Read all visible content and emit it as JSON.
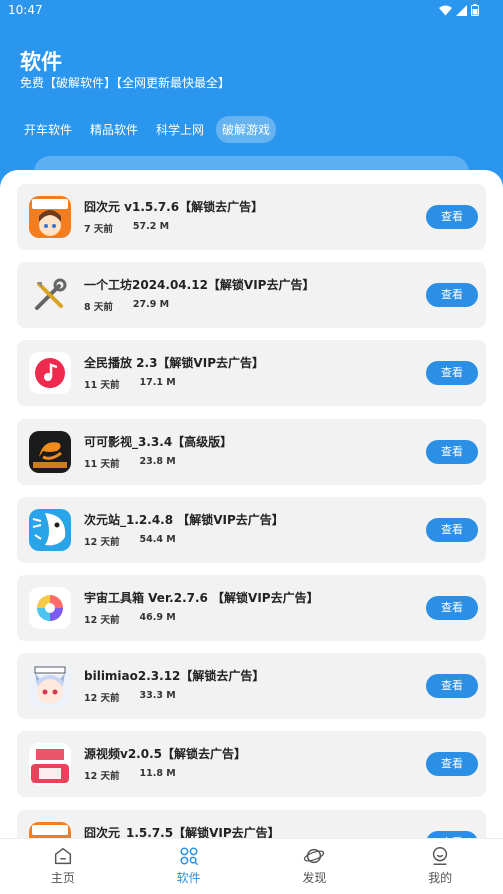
{
  "status": {
    "time": "10:47"
  },
  "header": {
    "title": "软件",
    "subtitle": "免费【破解软件】【全网更新最快最全】"
  },
  "tabs": [
    {
      "label": "开车软件",
      "active": false
    },
    {
      "label": "精品软件",
      "active": false
    },
    {
      "label": "科学上网",
      "active": false
    },
    {
      "label": "破解游戏",
      "active": true
    }
  ],
  "view_label": "查看",
  "apps": [
    {
      "title": "囧次元 v1.5.7.6【解锁去广告】",
      "age": "7 天前",
      "size": "57.2 M",
      "icon": "jiongciyuan-icon"
    },
    {
      "title": "一个工坊2024.04.12【解锁VIP去广告】",
      "age": "8 天前",
      "size": "27.9 M",
      "icon": "tools-icon"
    },
    {
      "title": "全民播放 2.3【解锁VIP去广告】",
      "age": "11 天前",
      "size": "17.1 M",
      "icon": "music-player-icon"
    },
    {
      "title": "可可影视_3.3.4【高级版】",
      "age": "11 天前",
      "size": "23.8 M",
      "icon": "kekys-icon"
    },
    {
      "title": "次元站_1.2.4.8 【解锁VIP去广告】",
      "age": "12 天前",
      "size": "54.4 M",
      "icon": "ciyuanzhan-icon"
    },
    {
      "title": "宇宙工具箱 Ver.2.7.6 【解锁VIP去广告】",
      "age": "12 天前",
      "size": "46.9 M",
      "icon": "universe-toolbox-icon"
    },
    {
      "title": "bilimiao2.3.12【解锁去广告】",
      "age": "12 天前",
      "size": "33.3 M",
      "icon": "bilimiao-icon"
    },
    {
      "title": "源视频v2.0.5【解锁去广告】",
      "age": "12 天前",
      "size": "11.8 M",
      "icon": "youyuan-video-icon"
    },
    {
      "title": "囧次元_1.5.7.5【解锁VIP去广告】",
      "age": "",
      "size": "",
      "icon": "jiongciyuan-icon"
    }
  ],
  "nav": [
    {
      "label": "主页",
      "icon": "home-icon",
      "active": false
    },
    {
      "label": "软件",
      "icon": "apps-icon",
      "active": true
    },
    {
      "label": "发现",
      "icon": "planet-icon",
      "active": false
    },
    {
      "label": "我的",
      "icon": "profile-icon",
      "active": false
    }
  ],
  "colors": {
    "primary": "#2b96ee",
    "button": "#2b8fe6",
    "card": "#f2f2f2"
  }
}
